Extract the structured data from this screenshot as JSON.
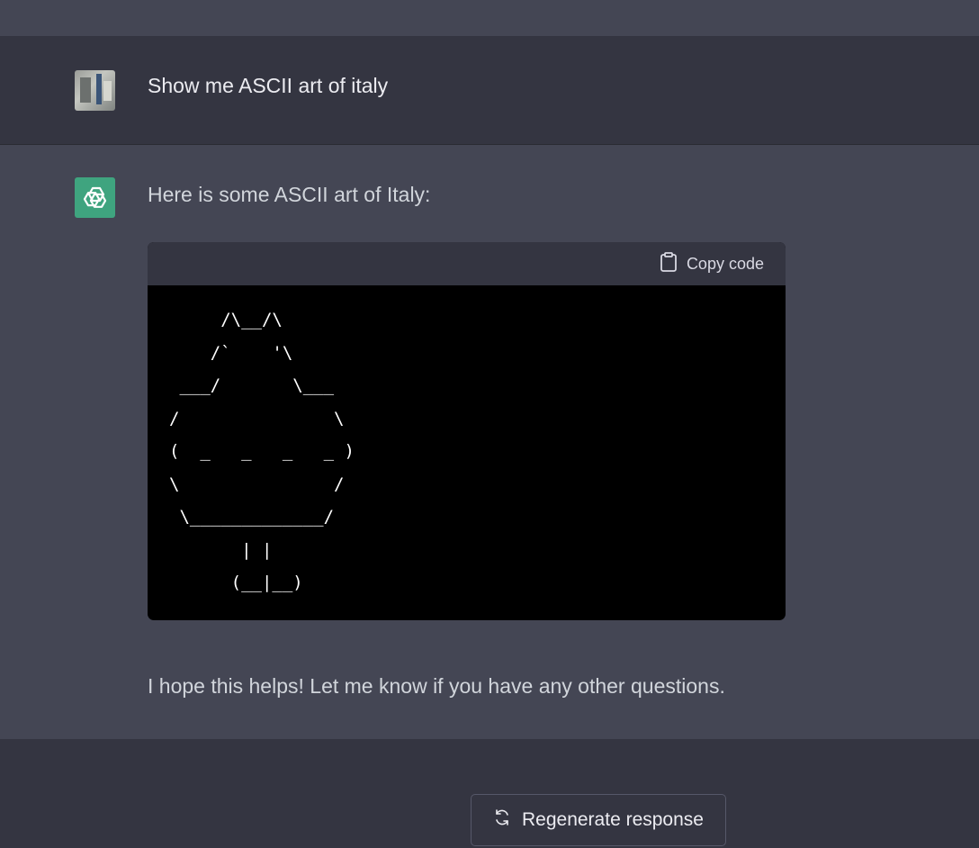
{
  "user_message": {
    "avatar": "user-avatar-image",
    "text": "Show me ASCII art of italy"
  },
  "assistant_message": {
    "avatar": "openai-logo-icon",
    "intro": "Here is some ASCII art of Italy:",
    "code_block": {
      "copy_icon": "clipboard-icon",
      "copy_label": "Copy code",
      "code": "     /\\__/\\\n    /`    '\\\n ___/       \\___\n/               \\\n(  _   _   _   _ )\n\\               /\n \\_____________/\n       | |\n      (__|__)"
    },
    "outro": "I hope this helps! Let me know if you have any other questions."
  },
  "footer": {
    "regenerate_icon": "refresh-icon",
    "regenerate_label": "Regenerate response"
  },
  "colors": {
    "assistant_bg": "#444654",
    "user_bg": "#343541",
    "code_bg": "#000000",
    "openai_green": "#3fa47f"
  }
}
